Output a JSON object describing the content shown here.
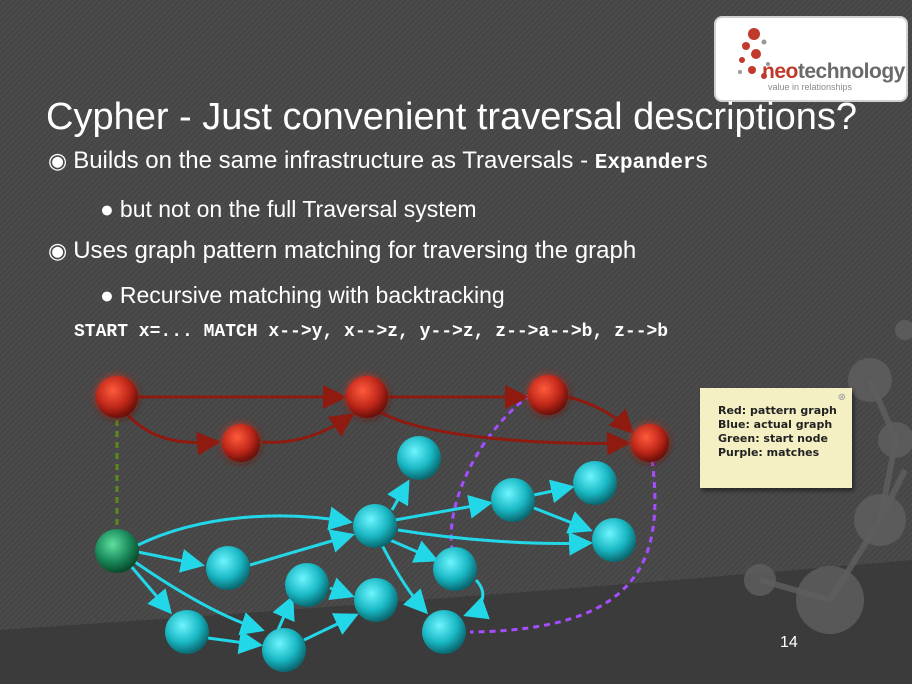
{
  "logo": {
    "brand_neo": "neo",
    "brand_tech": "technology",
    "tagline": "value in relationships"
  },
  "title": "Cypher - Just convenient traversal descriptions?",
  "bullets": [
    {
      "mark": "◉",
      "text": "Builds on the same infrastructure as Traversals - ",
      "code": "Expander",
      "suffix": "s"
    },
    {
      "mark": "●",
      "text": "but not on the full Traversal system"
    },
    {
      "mark": "◉",
      "text": "Uses graph pattern matching for traversing the graph"
    },
    {
      "mark": "●",
      "text": "Recursive matching with backtracking"
    }
  ],
  "code_line": "START x=... MATCH x-->y, x-->z, y-->z, z-->a-->b, z-->b",
  "legend": {
    "red": "Red: pattern graph",
    "blue": "Blue: actual graph",
    "green": "Green: start node",
    "purple": "Purple: matches"
  },
  "colors": {
    "red_node": "#c0281a",
    "cyan_node": "#19b8c4",
    "green_node": "#1a8a5a",
    "red_edge": "#8e1a10",
    "cyan_edge": "#22d8e8",
    "purple_match": "#a64dff",
    "green_match": "#5c8a1e"
  },
  "page_number": "14"
}
